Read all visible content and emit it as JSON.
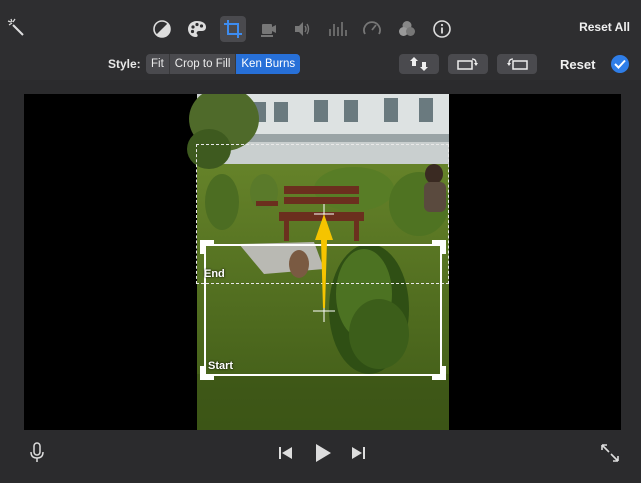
{
  "toolbar": {
    "reset_all_label": "Reset All",
    "tools": [
      "magic-wand-icon",
      "color-balance-icon",
      "color-palette-icon",
      "crop-icon",
      "camera-stabilize-icon",
      "volume-icon",
      "equalizer-icon",
      "speedometer-icon",
      "filter-icon",
      "info-icon"
    ],
    "active_tool": "crop-icon"
  },
  "style_bar": {
    "label": "Style:",
    "options": [
      "Fit",
      "Crop to Fill",
      "Ken Burns"
    ],
    "selected": "Ken Burns",
    "reset_label": "Reset"
  },
  "viewer": {
    "end_label": "End",
    "start_label": "Start"
  },
  "colors": {
    "accent": "#2770d8",
    "arrow": "#f5c400"
  }
}
